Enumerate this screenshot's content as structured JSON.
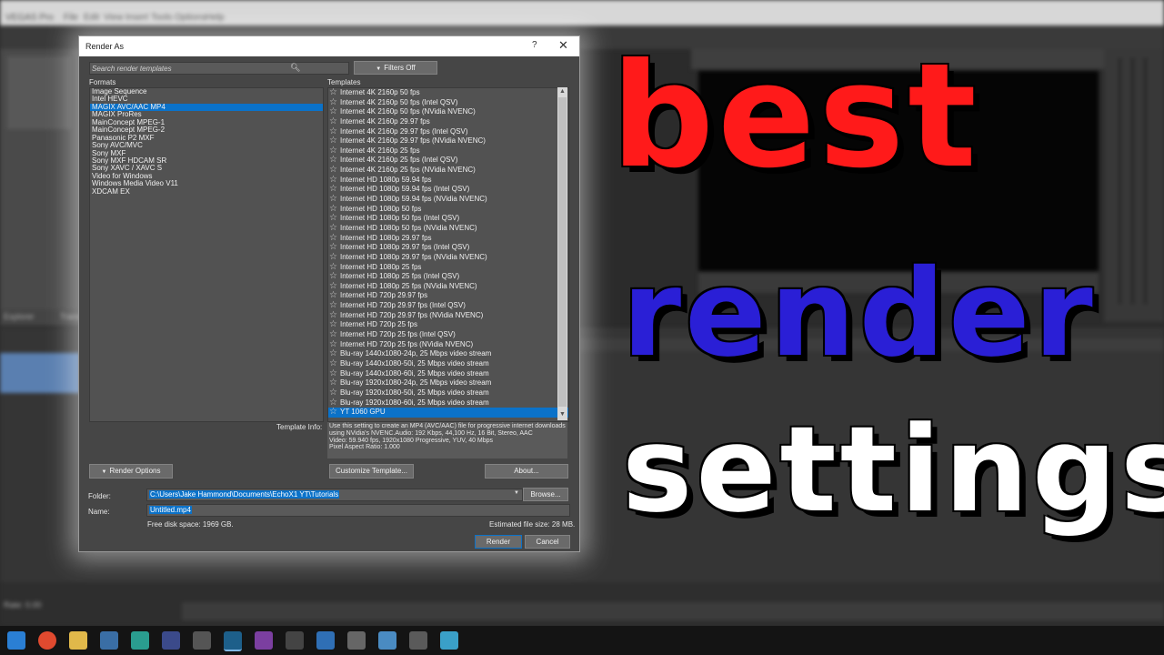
{
  "background_app": {
    "menu": [
      "File",
      "Edit",
      "View",
      "Insert",
      "Tools",
      "Options",
      "Help"
    ],
    "window_title": "VEGAS Pro",
    "tabs": [
      "Explorer",
      "Transitions"
    ],
    "zoom_label": "Rate: 0.00"
  },
  "dialog": {
    "title": "Render As",
    "help_glyph": "?",
    "close_glyph": "✕",
    "search_placeholder": "Search render templates",
    "filters_label": "Filters Off",
    "formats_label": "Formats",
    "templates_label": "Templates",
    "formats": [
      "Image Sequence",
      "Intel HEVC",
      "MAGIX AVC/AAC MP4",
      "MAGIX ProRes",
      "MainConcept MPEG-1",
      "MainConcept MPEG-2",
      "Panasonic P2 MXF",
      "Sony AVC/MVC",
      "Sony MXF",
      "Sony MXF HDCAM SR",
      "Sony XAVC / XAVC S",
      "Video for Windows",
      "Windows Media Video V11",
      "XDCAM EX"
    ],
    "selected_format": "MAGIX AVC/AAC MP4",
    "templates": [
      "Internet 4K 2160p 50 fps",
      "Internet 4K 2160p 50 fps (Intel QSV)",
      "Internet 4K 2160p 50 fps (NVidia NVENC)",
      "Internet 4K 2160p 29.97 fps",
      "Internet 4K 2160p 29.97 fps (Intel QSV)",
      "Internet 4K 2160p 29.97 fps (NVidia NVENC)",
      "Internet 4K 2160p 25 fps",
      "Internet 4K 2160p 25 fps (Intel QSV)",
      "Internet 4K 2160p 25 fps (NVidia NVENC)",
      "Internet HD 1080p 59.94 fps",
      "Internet HD 1080p 59.94 fps (Intel QSV)",
      "Internet HD 1080p 59.94 fps (NVidia NVENC)",
      "Internet HD 1080p 50 fps",
      "Internet HD 1080p 50 fps (Intel QSV)",
      "Internet HD 1080p 50 fps (NVidia NVENC)",
      "Internet HD 1080p 29.97 fps",
      "Internet HD 1080p 29.97 fps (Intel QSV)",
      "Internet HD 1080p 29.97 fps (NVidia NVENC)",
      "Internet HD 1080p 25 fps",
      "Internet HD 1080p 25 fps (Intel QSV)",
      "Internet HD 1080p 25 fps (NVidia NVENC)",
      "Internet HD 720p 29.97 fps",
      "Internet HD 720p 29.97 fps (Intel QSV)",
      "Internet HD 720p 29.97 fps (NVidia NVENC)",
      "Internet HD 720p 25 fps",
      "Internet HD 720p 25 fps (Intel QSV)",
      "Internet HD 720p 25 fps (NVidia NVENC)",
      "Blu-ray 1440x1080-24p, 25 Mbps video stream",
      "Blu-ray 1440x1080-50i, 25 Mbps video stream",
      "Blu-ray 1440x1080-60i, 25 Mbps video stream",
      "Blu-ray 1920x1080-24p, 25 Mbps video stream",
      "Blu-ray 1920x1080-50i, 25 Mbps video stream",
      "Blu-ray 1920x1080-60i, 25 Mbps video stream",
      "YT 1060 GPU"
    ],
    "selected_template": "YT 1060 GPU",
    "template_info_label": "Template Info:",
    "template_info": [
      "Use this setting to create an MP4 (AVC/AAC) file for progressive internet downloads",
      "using NVidia's NVENC.Audio: 192 Kbps, 44,100 Hz, 16 Bit, Stereo, AAC",
      "Video: 59.940 fps, 1920x1080 Progressive, YUV, 40 Mbps",
      "Pixel Aspect Ratio: 1.000"
    ],
    "render_options_label": "Render Options",
    "customize_label": "Customize Template...",
    "about_label": "About...",
    "folder_label": "Folder:",
    "folder_value": "C:\\Users\\Jake Hammond\\Documents\\EchoX1 YT\\Tutorials",
    "browse_label": "Browse...",
    "name_label": "Name:",
    "name_value": "Untitled.mp4",
    "free_space": "Free disk space: 1969 GB.",
    "estimated_size": "Estimated file size: 28 MB.",
    "render_label": "Render",
    "cancel_label": "Cancel"
  },
  "overlay": {
    "line1": "best",
    "line2": "render",
    "line3": "settings",
    "colors": {
      "line1": "#ff1a1a",
      "line2": "#2a1fd6",
      "line3": "#ffffff"
    }
  },
  "taskbar": {
    "icons": [
      "windows-start",
      "search",
      "task-view",
      "chrome",
      "file-explorer",
      "store",
      "app",
      "app",
      "app",
      "app",
      "vegas",
      "app",
      "app",
      "app",
      "app",
      "app",
      "app",
      "app",
      "app"
    ]
  }
}
